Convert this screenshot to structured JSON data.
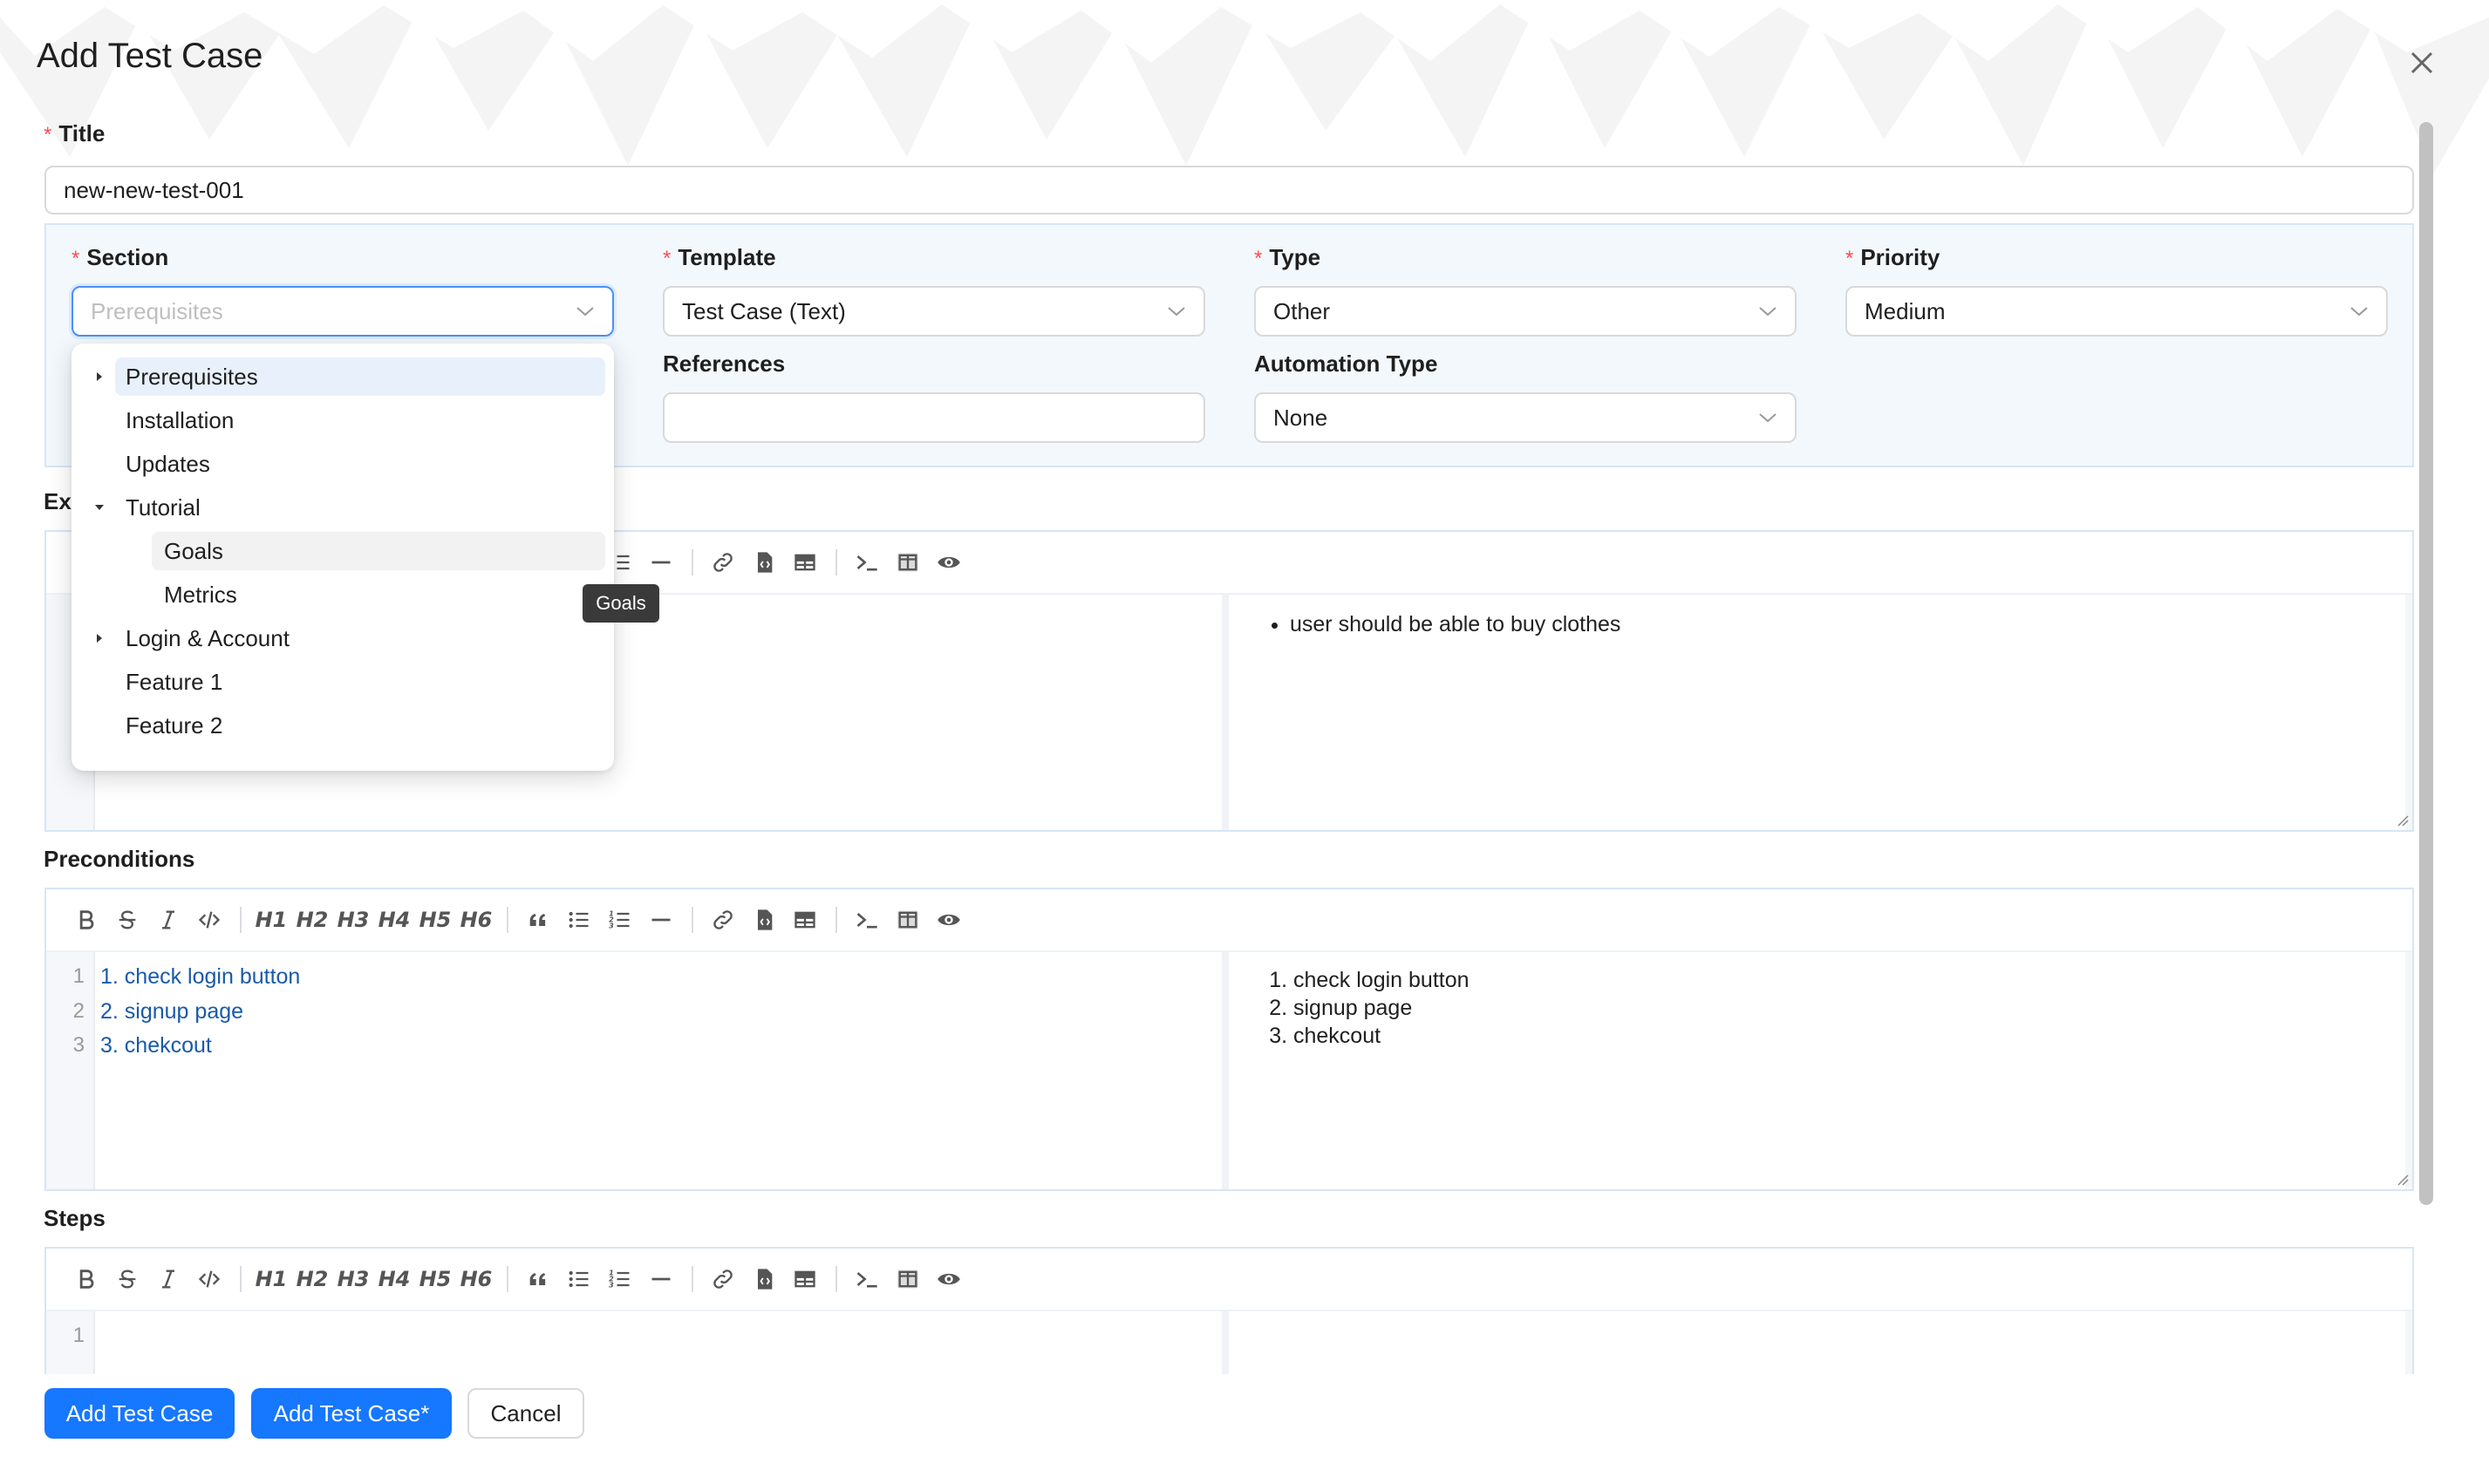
{
  "modal": {
    "title": "Add Test Case",
    "close_icon": "close-icon"
  },
  "form": {
    "title_label": "Title",
    "title_value": "new-new-test-001",
    "section_label": "Section",
    "section_placeholder": "Prerequisites",
    "template_label": "Template",
    "template_value": "Test Case (Text)",
    "type_label": "Type",
    "type_value": "Other",
    "priority_label": "Priority",
    "priority_value": "Medium",
    "references_label": "References",
    "references_value": "",
    "automation_label": "Automation Type",
    "automation_value": "None",
    "expected_label_partial": "Ex"
  },
  "section_tree": [
    {
      "label": "Prerequisites",
      "expanded": false,
      "has_children": true,
      "level": 0
    },
    {
      "label": "Installation",
      "has_children": false,
      "level": 0
    },
    {
      "label": "Updates",
      "has_children": false,
      "level": 0
    },
    {
      "label": "Tutorial",
      "expanded": true,
      "has_children": true,
      "level": 0
    },
    {
      "label": "Goals",
      "has_children": false,
      "level": 1
    },
    {
      "label": "Metrics",
      "has_children": false,
      "level": 1
    },
    {
      "label": "Login & Account",
      "expanded": false,
      "has_children": true,
      "level": 0
    },
    {
      "label": "Feature 1",
      "has_children": false,
      "level": 0
    },
    {
      "label": "Feature 2",
      "has_children": false,
      "level": 0
    }
  ],
  "tooltip": {
    "text": "Goals"
  },
  "toolbar": {
    "headings": [
      "H1",
      "H2",
      "H3",
      "H4",
      "H5",
      "H6"
    ],
    "icons": [
      "bold-icon",
      "strikethrough-icon",
      "italic-icon",
      "code-icon",
      "quote-icon",
      "bullet-list-icon",
      "numbered-list-icon",
      "horizontal-rule-icon",
      "link-icon",
      "code-block-icon",
      "table-icon",
      "terminal-icon",
      "split-view-icon",
      "preview-icon"
    ]
  },
  "editors": {
    "expected": {
      "preview": [
        "user should be able to buy clothes"
      ]
    },
    "preconditions": {
      "label": "Preconditions",
      "lines": [
        "1",
        "2",
        "3"
      ],
      "code": [
        "1. check login button",
        "2. signup page",
        "3. chekcout"
      ],
      "preview": [
        "check login button",
        "signup page",
        "chekcout"
      ]
    },
    "steps": {
      "label": "Steps",
      "lines": [
        "1"
      ],
      "code": []
    }
  },
  "buttons": {
    "add": "Add Test Case",
    "add_more": "Add Test Case*",
    "cancel": "Cancel"
  },
  "colors": {
    "primary": "#1677ff",
    "required": "#ff4d4f",
    "panel_bg": "#f3f8fd",
    "code_text": "#1a5aa8"
  }
}
